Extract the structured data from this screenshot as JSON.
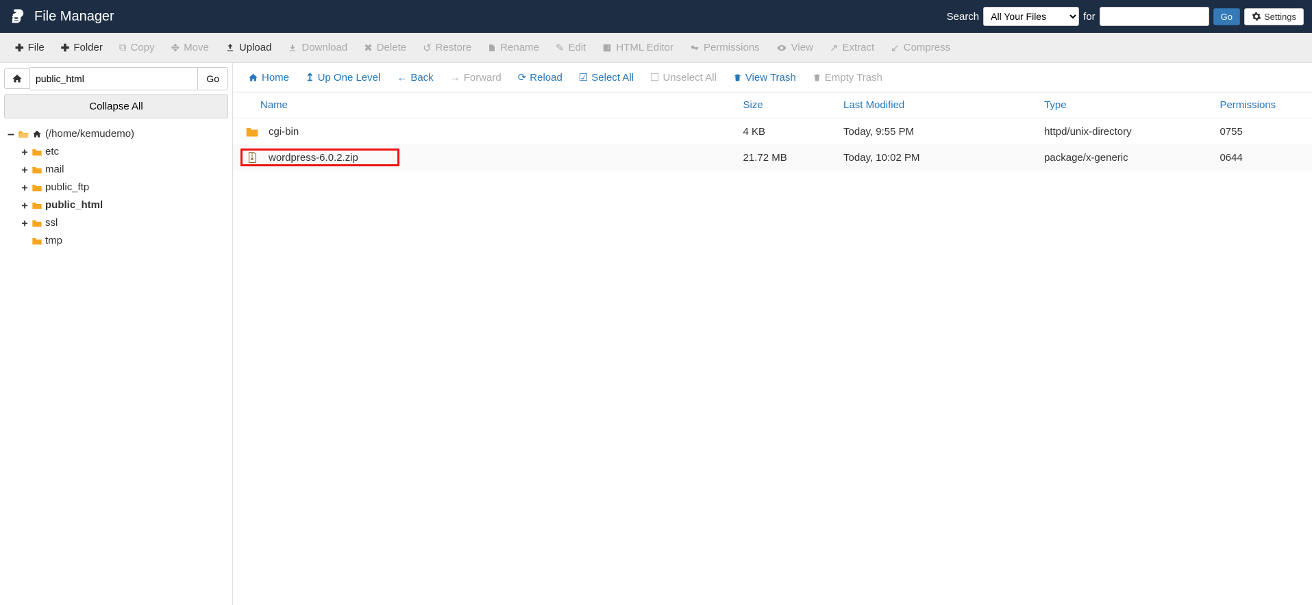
{
  "header": {
    "app_title": "File Manager",
    "search_label": "Search",
    "for_label": "for",
    "search_scope_selected": "All Your Files",
    "search_scope_options": [
      "All Your Files"
    ],
    "search_value": "",
    "go_label": "Go",
    "settings_label": "Settings"
  },
  "toolbar": {
    "file": "File",
    "folder": "Folder",
    "copy": "Copy",
    "move": "Move",
    "upload": "Upload",
    "download": "Download",
    "delete": "Delete",
    "restore": "Restore",
    "rename": "Rename",
    "edit": "Edit",
    "html_editor": "HTML Editor",
    "permissions": "Permissions",
    "view": "View",
    "extract": "Extract",
    "compress": "Compress"
  },
  "sidebar": {
    "path_value": "public_html",
    "go_label": "Go",
    "collapse_label": "Collapse All",
    "tree": {
      "root": {
        "label": "(/home/kemudemo)",
        "expander": "–"
      },
      "children": [
        {
          "label": "etc",
          "expander": "+"
        },
        {
          "label": "mail",
          "expander": "+"
        },
        {
          "label": "public_ftp",
          "expander": "+"
        },
        {
          "label": "public_html",
          "expander": "+",
          "bold": true
        },
        {
          "label": "ssl",
          "expander": "+"
        },
        {
          "label": "tmp",
          "expander": ""
        }
      ]
    }
  },
  "navbar": {
    "home": "Home",
    "up": "Up One Level",
    "back": "Back",
    "forward": "Forward",
    "reload": "Reload",
    "select_all": "Select All",
    "unselect_all": "Unselect All",
    "view_trash": "View Trash",
    "empty_trash": "Empty Trash"
  },
  "listing": {
    "columns": {
      "name": "Name",
      "size": "Size",
      "modified": "Last Modified",
      "type": "Type",
      "permissions": "Permissions"
    },
    "rows": [
      {
        "icon": "folder",
        "name": "cgi-bin",
        "size": "4 KB",
        "modified": "Today, 9:55 PM",
        "type": "httpd/unix-directory",
        "permissions": "0755",
        "highlight": false
      },
      {
        "icon": "archive",
        "name": "wordpress-6.0.2.zip",
        "size": "21.72 MB",
        "modified": "Today, 10:02 PM",
        "type": "package/x-generic",
        "permissions": "0644",
        "highlight": true
      }
    ]
  }
}
